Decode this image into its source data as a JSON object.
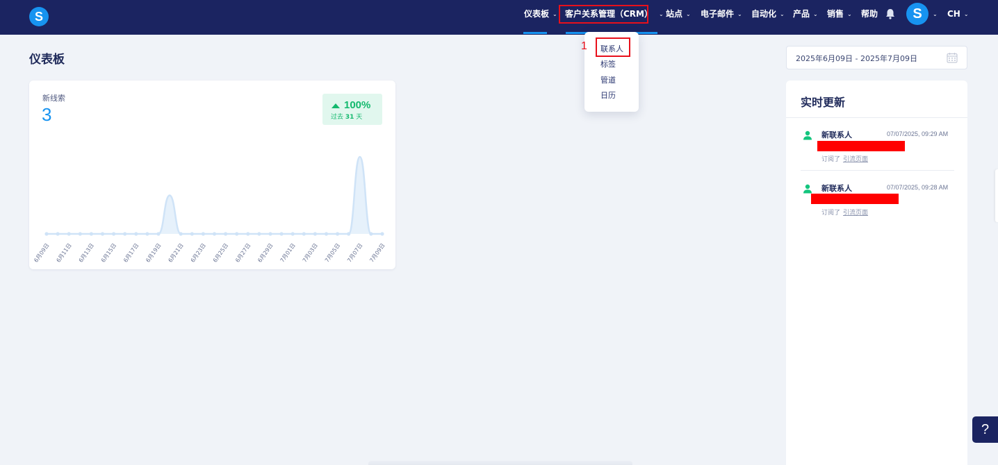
{
  "header": {
    "logo_letter": "S",
    "nav": [
      {
        "label": "仪表板"
      },
      {
        "label": "客户关系管理（CRM）"
      },
      {
        "label": "站点"
      },
      {
        "label": "电子邮件"
      },
      {
        "label": "自动化"
      },
      {
        "label": "产品"
      },
      {
        "label": "销售"
      },
      {
        "label": "帮助"
      }
    ],
    "avatar_letter": "S",
    "language": "CH"
  },
  "crm_menu": {
    "annotation_number": "1",
    "items": [
      {
        "label": "联系人"
      },
      {
        "label": "标签"
      },
      {
        "label": "管道"
      },
      {
        "label": "日历"
      }
    ]
  },
  "page": {
    "title": "仪表板",
    "date_range": "2025年6月09日 - 2025年7月09日"
  },
  "leads_card": {
    "label": "新线索",
    "value": "3",
    "change_pct": "100%",
    "change_period_prefix": "过去",
    "change_period_days": "31",
    "change_period_suffix": "天"
  },
  "chart_data": {
    "type": "area",
    "x": [
      "6月09日",
      "6月10日",
      "6月11日",
      "6月12日",
      "6月13日",
      "6月14日",
      "6月15日",
      "6月16日",
      "6月17日",
      "6月18日",
      "6月19日",
      "6月20日",
      "6月21日",
      "6月22日",
      "6月23日",
      "6月24日",
      "6月25日",
      "6月26日",
      "6月27日",
      "6月28日",
      "6月29日",
      "6月30日",
      "7月01日",
      "7月02日",
      "7月03日",
      "7月04日",
      "7月05日",
      "7月06日",
      "7月07日",
      "7月08日",
      "7月09日"
    ],
    "values": [
      0,
      0,
      0,
      0,
      0,
      0,
      0,
      0,
      0,
      0,
      0,
      1,
      0,
      0,
      0,
      0,
      0,
      0,
      0,
      0,
      0,
      0,
      0,
      0,
      0,
      0,
      0,
      0,
      2,
      0,
      0
    ],
    "tick_labels": [
      "6月09日",
      "6月11日",
      "6月13日",
      "6月15日",
      "6月17日",
      "6月19日",
      "6月21日",
      "6月23日",
      "6月25日",
      "6月27日",
      "6月29日",
      "7月01日",
      "7月03日",
      "7月05日",
      "7月07日",
      "7月09日"
    ],
    "ylim": [
      0,
      2
    ],
    "grid": false,
    "colors": {
      "line": "#cfe3f7",
      "fill": "#e6f1fb"
    }
  },
  "realtime": {
    "title": "实时更新",
    "items": [
      {
        "name": "新联系人",
        "time": "07/07/2025, 09:29 AM",
        "action": "订阅了",
        "link": "引流页面"
      },
      {
        "name": "新联系人",
        "time": "07/07/2025, 09:28 AM",
        "action": "订阅了",
        "link": "引流页面"
      }
    ]
  },
  "help": {
    "label": "?"
  },
  "colors": {
    "nav_bg": "#1b2461",
    "accent": "#1793f0",
    "success": "#14b96e",
    "highlight": "#e8101b"
  }
}
